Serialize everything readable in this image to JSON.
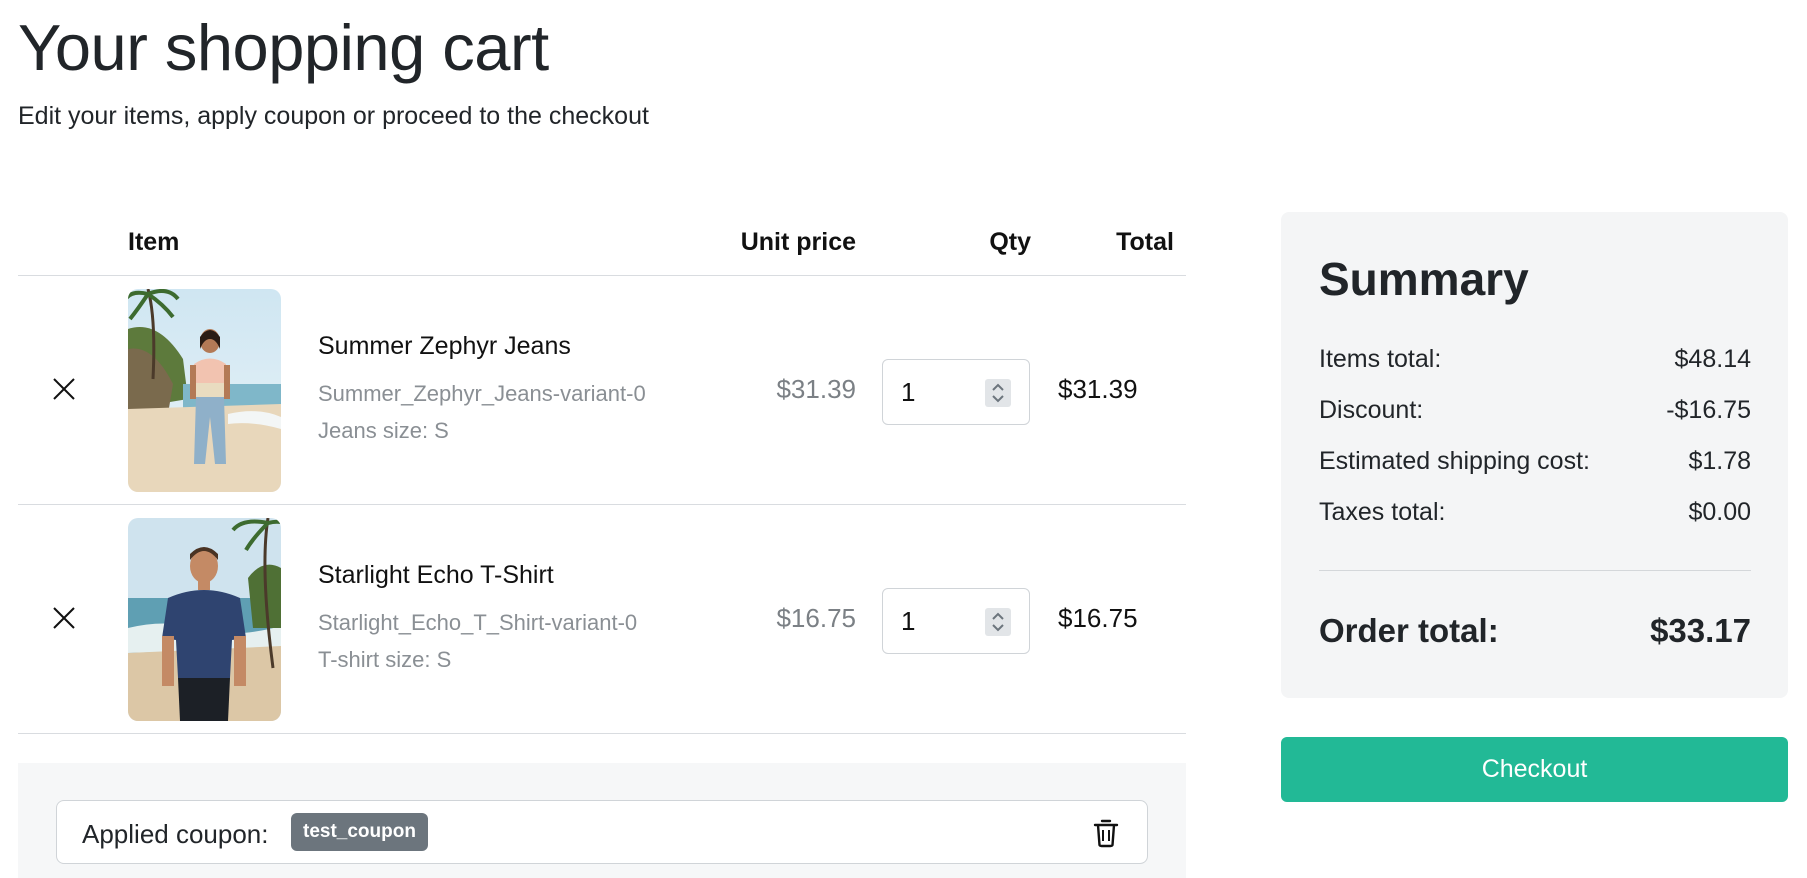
{
  "header": {
    "title": "Your shopping cart",
    "subtitle": "Edit your items, apply coupon or proceed to the checkout"
  },
  "table": {
    "headers": {
      "item": "Item",
      "unit_price": "Unit price",
      "qty": "Qty",
      "total": "Total"
    }
  },
  "items": [
    {
      "name": "Summer Zephyr Jeans",
      "variant": "Summer_Zephyr_Jeans-variant-0",
      "size": "Jeans size: S",
      "unit_price": "$31.39",
      "qty": "1",
      "total": "$31.39",
      "image": "woman-on-beach-photo"
    },
    {
      "name": "Starlight Echo T-Shirt",
      "variant": "Starlight_Echo_T_Shirt-variant-0",
      "size": "T-shirt size: S",
      "unit_price": "$16.75",
      "qty": "1",
      "total": "$16.75",
      "image": "man-on-beach-photo"
    }
  ],
  "coupon": {
    "label": "Applied coupon:",
    "code": "test_coupon"
  },
  "summary": {
    "title": "Summary",
    "rows": [
      {
        "label": "Items total:",
        "value": "$48.14"
      },
      {
        "label": "Discount:",
        "value": "-$16.75"
      },
      {
        "label": "Estimated shipping cost:",
        "value": "$1.78"
      },
      {
        "label": "Taxes total:",
        "value": "$0.00"
      }
    ],
    "order_total_label": "Order total:",
    "order_total_value": "$33.17"
  },
  "checkout": {
    "label": "Checkout"
  },
  "colors": {
    "accent": "#22b996",
    "badge": "#6c757d",
    "muted_text": "#8a8f94"
  }
}
